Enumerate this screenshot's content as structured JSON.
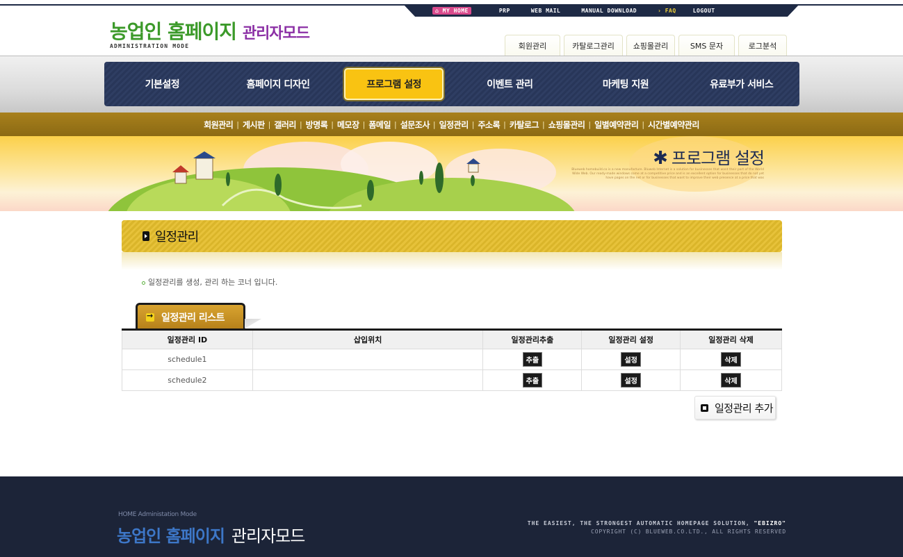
{
  "topbar": {
    "items": [
      "MY HOME",
      "PRP",
      "WEB MAIL",
      "MANUAL DOWNLOAD",
      "FAQ",
      "LOGOUT"
    ]
  },
  "logo": {
    "title": "농업인 홈페이지",
    "subtitle": "관리자모드",
    "english": "ADMINISTRATION MODE"
  },
  "top_tabs": [
    "회원관리",
    "카탈로그관리",
    "쇼핑몰관리",
    "SMS 문자",
    "로그분석"
  ],
  "main_menu": {
    "items": [
      "기본설정",
      "홈페이지 디자인",
      "프로그램 설정",
      "이벤트 관리",
      "마케팅 지원",
      "유료부가 서비스"
    ],
    "active": "프로그램 설정"
  },
  "sub_menu": [
    "회원관리",
    "게시판",
    "갤러리",
    "방명록",
    "메모장",
    "폼메일",
    "설문조사",
    "일정관리",
    "주소록",
    "카탈로그",
    "쇼핑몰관리",
    "일별예약관리",
    "시간별예약관리"
  ],
  "banner": {
    "title": "프로그램 설정",
    "small_text": "Blueweb homebuild.co is a new manufacture. Bluweb Internet is a solution for businesses that want their part of the World Wide Web. Our ready-made windows come at a competitive price and is an excellent option for businesses that do not yet have pages on the net or for businesses that want to improve their web presence at a price that was"
  },
  "section": {
    "title": "일정관리",
    "description": "일정관리를 생성, 관리 하는 코너 입니다."
  },
  "list": {
    "tab_label": "일정관리 리스트",
    "columns": [
      "일정관리 ID",
      "삽입위치",
      "일정관리추출",
      "일정관리 설정",
      "일정관리 삭제"
    ],
    "rows": [
      {
        "id": "schedule1",
        "position": "",
        "extract": "추출",
        "settings": "설정",
        "delete": "삭제"
      },
      {
        "id": "schedule2",
        "position": "",
        "extract": "추출",
        "settings": "설정",
        "delete": "삭제"
      }
    ],
    "add_button": "일정관리 추가"
  },
  "footer": {
    "small": "HOME Administation Mode",
    "title": "농업인 홈페이지",
    "subtitle": "관리자모드",
    "slogan_prefix": "THE EASIEST, THE STRONGEST AUTOMATIC HOMEPAGE SOLUTION, ",
    "slogan_brand": "\"EBIZRO\"",
    "copyright": "COPYRIGHT (C) BLUEWEB.CO.LTD., ALL RIGHTS RESERVED"
  },
  "colors": {
    "navy": "#283659",
    "accent_yellow": "#f9c312",
    "brown": "#8b6a14",
    "logo_green": "#3c9a2a",
    "logo_purple": "#8b2fa5",
    "footer_blue": "#3d77c8"
  }
}
